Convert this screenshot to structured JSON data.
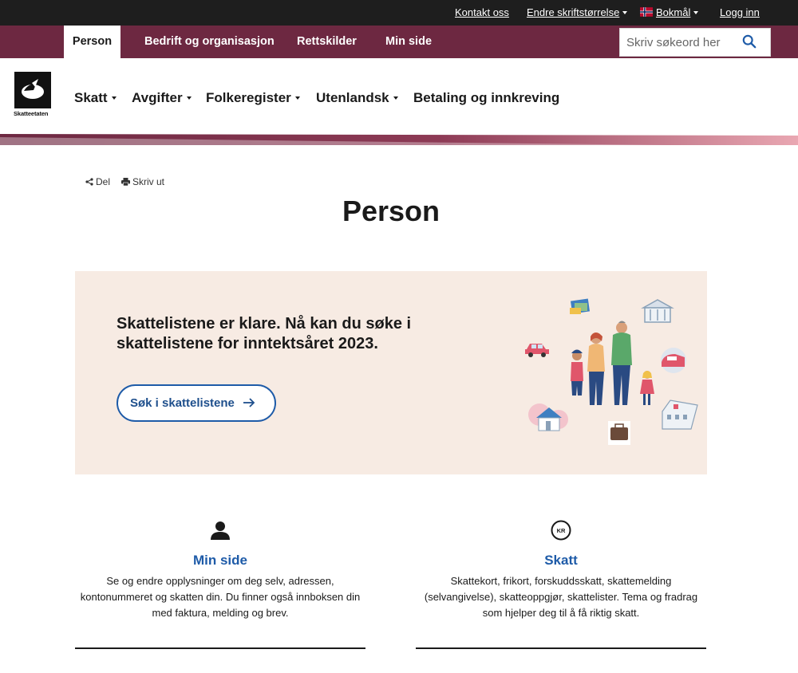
{
  "utility_bar": {
    "contact": "Kontakt oss",
    "font_size": "Endre skriftstørrelse",
    "language": "Bokmål",
    "login": "Logg inn"
  },
  "nav": {
    "tabs": [
      {
        "label": "Person",
        "active": true
      },
      {
        "label": "Bedrift og organisasjon",
        "active": false
      },
      {
        "label": "Rettskilder",
        "active": false
      },
      {
        "label": "Min side",
        "active": false
      }
    ],
    "search_placeholder": "Skriv søkeord her"
  },
  "logo": {
    "text": "Skatteetaten"
  },
  "main_menu": [
    {
      "label": "Skatt"
    },
    {
      "label": "Avgifter"
    },
    {
      "label": "Folkeregister"
    },
    {
      "label": "Utenlandsk"
    },
    {
      "label": "Betaling og innkreving"
    }
  ],
  "tools": {
    "share": "Del",
    "print": "Skriv ut"
  },
  "page": {
    "title": "Person"
  },
  "banner": {
    "heading": "Skattelistene er klare. Nå kan du søke i skattelistene for inntektsåret 2023.",
    "button": "Søk i skattelistene"
  },
  "cards": [
    {
      "title": "Min side",
      "text": "Se og endre opplysninger om deg selv, adressen, kontonummeret og skatten din. Du finner også innboksen din med faktura, melding og brev.",
      "icon": "person-icon"
    },
    {
      "title": "Skatt",
      "text": "Skattekort, frikort, forskuddsskatt, skattemelding (selvangivelse), skatteoppgjør, skattelister. Tema og fradrag som hjelper deg til å få riktig skatt.",
      "icon": "kr-coin-icon",
      "icon_text": "KR"
    }
  ],
  "colors": {
    "brand_burgundy": "#6d2841",
    "link_blue": "#1e5ba8",
    "banner_bg": "#f7ebe3",
    "topbar": "#1e1e1e"
  }
}
